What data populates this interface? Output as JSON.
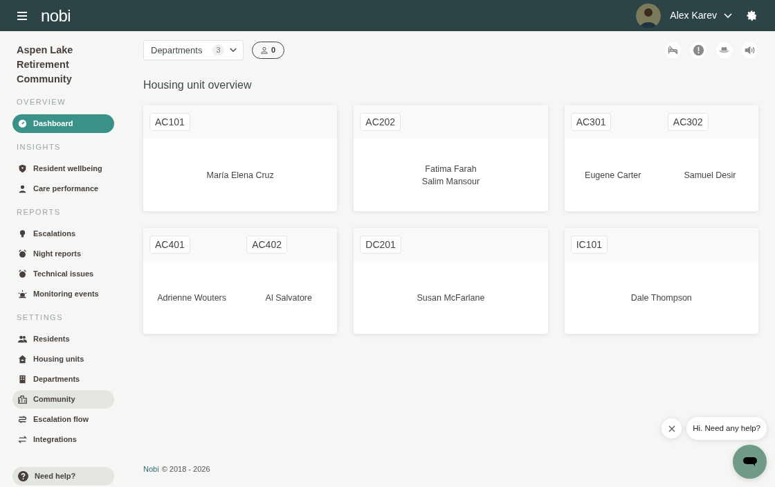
{
  "header": {
    "logo": "nobi",
    "user": {
      "name": "Alex Karev"
    }
  },
  "sidebar": {
    "community": [
      "Aspen Lake",
      "Retirement",
      "Community"
    ],
    "sections": [
      {
        "title": "OVERVIEW",
        "items": [
          {
            "label": "Dashboard",
            "selected": true,
            "hovered": false
          }
        ]
      },
      {
        "title": "INSIGHTS",
        "items": [
          {
            "label": "Resident wellbeing",
            "selected": false,
            "hovered": false
          },
          {
            "label": "Care performance",
            "selected": false,
            "hovered": false
          }
        ]
      },
      {
        "title": "REPORTS",
        "items": [
          {
            "label": "Escalations",
            "selected": false,
            "hovered": false
          },
          {
            "label": "Night reports",
            "selected": false,
            "hovered": false
          },
          {
            "label": "Technical issues",
            "selected": false,
            "hovered": false
          },
          {
            "label": "Monitoring events",
            "selected": false,
            "hovered": false
          }
        ]
      },
      {
        "title": "SETTINGS",
        "items": [
          {
            "label": "Residents",
            "selected": false,
            "hovered": false
          },
          {
            "label": "Housing units",
            "selected": false,
            "hovered": false
          },
          {
            "label": "Departments",
            "selected": false,
            "hovered": false
          },
          {
            "label": "Community",
            "selected": false,
            "hovered": true
          },
          {
            "label": "Escalation flow",
            "selected": false,
            "hovered": false
          },
          {
            "label": "Integrations",
            "selected": false,
            "hovered": false
          }
        ]
      }
    ],
    "help": "Need help?"
  },
  "toolbar": {
    "departments": {
      "label": "Departments",
      "count": "3"
    },
    "caregivers": {
      "count": "0"
    }
  },
  "title": "Housing unit overview",
  "cards": [
    {
      "units": [
        {
          "code": "AC101",
          "residents": [
            "María Elena Cruz"
          ]
        }
      ]
    },
    {
      "units": [
        {
          "code": "AC202",
          "residents": [
            "Fatima Farah",
            "Salim Mansour"
          ]
        }
      ]
    },
    {
      "units": [
        {
          "code": "AC301",
          "residents": [
            "Eugene Carter"
          ]
        },
        {
          "code": "AC302",
          "residents": [
            "Samuel Desir"
          ]
        }
      ]
    },
    {
      "units": [
        {
          "code": "AC401",
          "residents": [
            "Adrienne Wouters"
          ]
        },
        {
          "code": "AC402",
          "residents": [
            "Al Salvatore"
          ]
        }
      ]
    },
    {
      "units": [
        {
          "code": "DC201",
          "residents": [
            "Susan McFarlane"
          ]
        }
      ]
    },
    {
      "units": [
        {
          "code": "IC101",
          "residents": [
            "Dale Thompson"
          ]
        }
      ]
    }
  ],
  "footer": {
    "brand": "Nobi",
    "text": "© 2018 - 2026"
  },
  "chat": {
    "message": "Hi. Need any help?"
  }
}
